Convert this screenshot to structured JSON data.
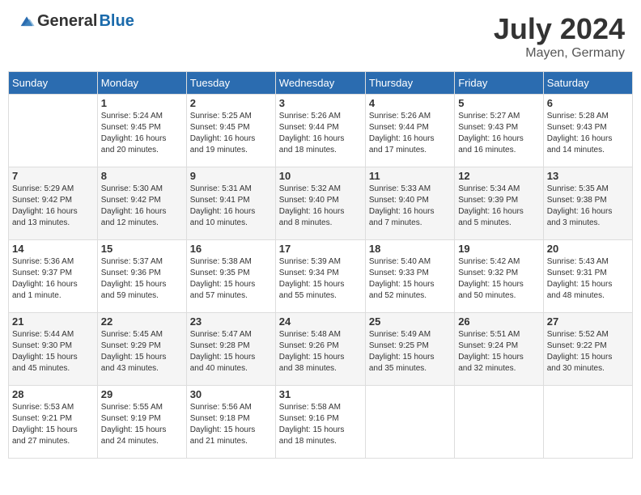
{
  "header": {
    "logo_general": "General",
    "logo_blue": "Blue",
    "month_title": "July 2024",
    "location": "Mayen, Germany"
  },
  "days_of_week": [
    "Sunday",
    "Monday",
    "Tuesday",
    "Wednesday",
    "Thursday",
    "Friday",
    "Saturday"
  ],
  "weeks": [
    [
      {
        "day": "",
        "info": ""
      },
      {
        "day": "1",
        "info": "Sunrise: 5:24 AM\nSunset: 9:45 PM\nDaylight: 16 hours\nand 20 minutes."
      },
      {
        "day": "2",
        "info": "Sunrise: 5:25 AM\nSunset: 9:45 PM\nDaylight: 16 hours\nand 19 minutes."
      },
      {
        "day": "3",
        "info": "Sunrise: 5:26 AM\nSunset: 9:44 PM\nDaylight: 16 hours\nand 18 minutes."
      },
      {
        "day": "4",
        "info": "Sunrise: 5:26 AM\nSunset: 9:44 PM\nDaylight: 16 hours\nand 17 minutes."
      },
      {
        "day": "5",
        "info": "Sunrise: 5:27 AM\nSunset: 9:43 PM\nDaylight: 16 hours\nand 16 minutes."
      },
      {
        "day": "6",
        "info": "Sunrise: 5:28 AM\nSunset: 9:43 PM\nDaylight: 16 hours\nand 14 minutes."
      }
    ],
    [
      {
        "day": "7",
        "info": "Sunrise: 5:29 AM\nSunset: 9:42 PM\nDaylight: 16 hours\nand 13 minutes."
      },
      {
        "day": "8",
        "info": "Sunrise: 5:30 AM\nSunset: 9:42 PM\nDaylight: 16 hours\nand 12 minutes."
      },
      {
        "day": "9",
        "info": "Sunrise: 5:31 AM\nSunset: 9:41 PM\nDaylight: 16 hours\nand 10 minutes."
      },
      {
        "day": "10",
        "info": "Sunrise: 5:32 AM\nSunset: 9:40 PM\nDaylight: 16 hours\nand 8 minutes."
      },
      {
        "day": "11",
        "info": "Sunrise: 5:33 AM\nSunset: 9:40 PM\nDaylight: 16 hours\nand 7 minutes."
      },
      {
        "day": "12",
        "info": "Sunrise: 5:34 AM\nSunset: 9:39 PM\nDaylight: 16 hours\nand 5 minutes."
      },
      {
        "day": "13",
        "info": "Sunrise: 5:35 AM\nSunset: 9:38 PM\nDaylight: 16 hours\nand 3 minutes."
      }
    ],
    [
      {
        "day": "14",
        "info": "Sunrise: 5:36 AM\nSunset: 9:37 PM\nDaylight: 16 hours\nand 1 minute."
      },
      {
        "day": "15",
        "info": "Sunrise: 5:37 AM\nSunset: 9:36 PM\nDaylight: 15 hours\nand 59 minutes."
      },
      {
        "day": "16",
        "info": "Sunrise: 5:38 AM\nSunset: 9:35 PM\nDaylight: 15 hours\nand 57 minutes."
      },
      {
        "day": "17",
        "info": "Sunrise: 5:39 AM\nSunset: 9:34 PM\nDaylight: 15 hours\nand 55 minutes."
      },
      {
        "day": "18",
        "info": "Sunrise: 5:40 AM\nSunset: 9:33 PM\nDaylight: 15 hours\nand 52 minutes."
      },
      {
        "day": "19",
        "info": "Sunrise: 5:42 AM\nSunset: 9:32 PM\nDaylight: 15 hours\nand 50 minutes."
      },
      {
        "day": "20",
        "info": "Sunrise: 5:43 AM\nSunset: 9:31 PM\nDaylight: 15 hours\nand 48 minutes."
      }
    ],
    [
      {
        "day": "21",
        "info": "Sunrise: 5:44 AM\nSunset: 9:30 PM\nDaylight: 15 hours\nand 45 minutes."
      },
      {
        "day": "22",
        "info": "Sunrise: 5:45 AM\nSunset: 9:29 PM\nDaylight: 15 hours\nand 43 minutes."
      },
      {
        "day": "23",
        "info": "Sunrise: 5:47 AM\nSunset: 9:28 PM\nDaylight: 15 hours\nand 40 minutes."
      },
      {
        "day": "24",
        "info": "Sunrise: 5:48 AM\nSunset: 9:26 PM\nDaylight: 15 hours\nand 38 minutes."
      },
      {
        "day": "25",
        "info": "Sunrise: 5:49 AM\nSunset: 9:25 PM\nDaylight: 15 hours\nand 35 minutes."
      },
      {
        "day": "26",
        "info": "Sunrise: 5:51 AM\nSunset: 9:24 PM\nDaylight: 15 hours\nand 32 minutes."
      },
      {
        "day": "27",
        "info": "Sunrise: 5:52 AM\nSunset: 9:22 PM\nDaylight: 15 hours\nand 30 minutes."
      }
    ],
    [
      {
        "day": "28",
        "info": "Sunrise: 5:53 AM\nSunset: 9:21 PM\nDaylight: 15 hours\nand 27 minutes."
      },
      {
        "day": "29",
        "info": "Sunrise: 5:55 AM\nSunset: 9:19 PM\nDaylight: 15 hours\nand 24 minutes."
      },
      {
        "day": "30",
        "info": "Sunrise: 5:56 AM\nSunset: 9:18 PM\nDaylight: 15 hours\nand 21 minutes."
      },
      {
        "day": "31",
        "info": "Sunrise: 5:58 AM\nSunset: 9:16 PM\nDaylight: 15 hours\nand 18 minutes."
      },
      {
        "day": "",
        "info": ""
      },
      {
        "day": "",
        "info": ""
      },
      {
        "day": "",
        "info": ""
      }
    ]
  ]
}
